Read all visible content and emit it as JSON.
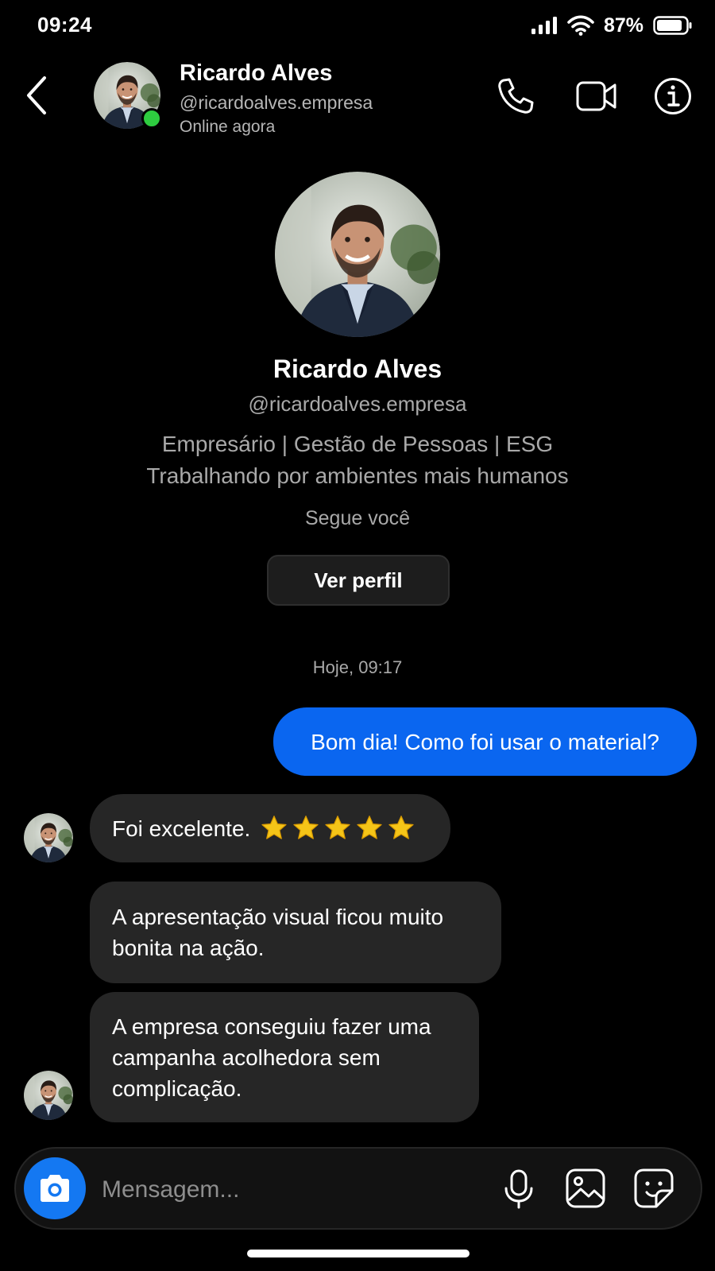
{
  "status_bar": {
    "time": "09:24",
    "battery_percent": "87%",
    "battery_level": 0.87
  },
  "header": {
    "name": "Ricardo Alves",
    "handle": "@ricardoalves.empresa",
    "status": "Online agora",
    "online": true,
    "icons": [
      "back-icon",
      "phone-icon",
      "video-icon",
      "info-icon"
    ]
  },
  "profile": {
    "name": "Ricardo Alves",
    "handle": "@ricardoalves.empresa",
    "bio_line_1": "Empresário | Gestão de Pessoas | ESG",
    "bio_line_2": "Trabalhando por ambientes mais humanos",
    "follows_you": "Segue você",
    "view_profile_label": "Ver perfil"
  },
  "chat": {
    "date_label": "Hoje, 09:17",
    "messages": [
      {
        "direction": "outgoing",
        "text": "Bom dia! Como foi usar o material?"
      },
      {
        "direction": "incoming",
        "text": "Foi excelente.",
        "stars": 5
      },
      {
        "direction": "incoming",
        "text": "A apresentação visual ficou muito bonita na ação."
      },
      {
        "direction": "incoming",
        "text": "A empresa conseguiu fazer uma campanha acolhedora sem complicação."
      }
    ]
  },
  "composer": {
    "placeholder": "Mensagem...",
    "icons": [
      "camera-icon",
      "microphone-icon",
      "gallery-icon",
      "sticker-icon"
    ]
  },
  "colors": {
    "background": "#000000",
    "outgoing_bubble": "#0a66f0",
    "incoming_bubble": "#262626",
    "camera_button": "#1478f2",
    "online_dot": "#2ecc40",
    "secondary_text": "#a9a9a9",
    "star": "#f5c518"
  }
}
